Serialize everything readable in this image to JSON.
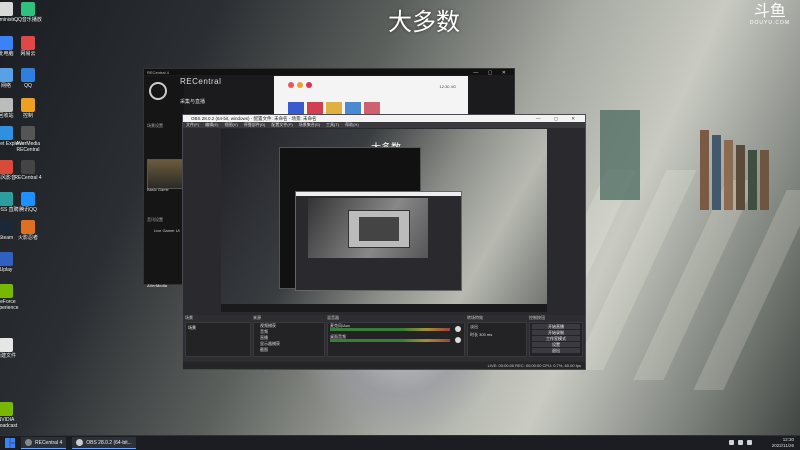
{
  "watermark": {
    "caption": "大多数",
    "logo_cn": "斗鱼",
    "logo_en": "DOUYU.COM"
  },
  "desktop_icons": [
    {
      "label": "Administr...",
      "color": "#d9d9d9"
    },
    {
      "label": "QQ音乐播放",
      "color": "#2ec27e"
    },
    {
      "label": "此电脑",
      "color": "#3b82f6"
    },
    {
      "label": "网易云",
      "color": "#e04848"
    },
    {
      "label": "网络",
      "color": "#5aa0e6"
    },
    {
      "label": "QQ",
      "color": "#2f7fe0"
    },
    {
      "label": "回收站",
      "color": "#bcbcbc"
    },
    {
      "label": "控制",
      "color": "#f0a020"
    },
    {
      "label": "Internet Explorer",
      "color": "#2f8fe0"
    },
    {
      "label": "AVerMedia RECentral",
      "color": "#555555"
    },
    {
      "label": "暴风影音",
      "color": "#d94a3a"
    },
    {
      "label": "RECentral 4",
      "color": "#444444"
    },
    {
      "label": "BOSS 直聘",
      "color": "#2d9e9e"
    },
    {
      "label": "腾讯QQ",
      "color": "#1e90ff"
    },
    {
      "label": "Steam",
      "color": "#1b2838"
    },
    {
      "label": "火影忍者",
      "color": "#e07020"
    },
    {
      "label": "Uplay",
      "color": "#3060c0"
    },
    {
      "label": "GeForce Experience",
      "color": "#76b900"
    },
    {
      "label": "新建文件",
      "color": "#e6e6e6"
    },
    {
      "label": "NVIDIA Broadcast",
      "color": "#76b900"
    }
  ],
  "recentral": {
    "title": "RECentral 4",
    "brand": "RECentral",
    "subtitle": "采集与直播",
    "section_preview": "场景设置",
    "thumb_label": "Basic Game",
    "section_sources": "音讯设置",
    "source_item": "Live Gamer Ul",
    "footer": "AVerMedia",
    "preview_time": "12:30",
    "preview_status": "4G"
  },
  "obs": {
    "title": "OBS 28.0.2 (64-bit, windows) - 配置文件: 未命名 - 场景: 未命名",
    "menu": [
      "文件(F)",
      "编辑(E)",
      "视图(V)",
      "停靠部件(D)",
      "配置文件(P)",
      "场景集合(S)",
      "工具(T)",
      "帮助(H)"
    ],
    "docks": {
      "scenes": {
        "header": "场景",
        "items": [
          "场景"
        ]
      },
      "sources": {
        "header": "来源",
        "items": [
          "视频捕获",
          "音频",
          "直播",
          "显示器捕获",
          "截图",
          "文本"
        ]
      },
      "mixer": {
        "header": "混音器",
        "channels": [
          "麦克风/Aux",
          "桌面音频"
        ]
      },
      "transitions": {
        "header": "转场特效",
        "type": "淡出",
        "duration_label": "时长",
        "duration": "300 ms"
      },
      "controls": {
        "header": "控制按钮",
        "buttons": [
          "开始直播",
          "开始录制",
          "工作室模式",
          "设置",
          "退出"
        ]
      }
    },
    "status": "LIVE: 00:00:00   REC: 00:00:00   CPU: 0.7%, 60.00 fps"
  },
  "taskbar": {
    "apps": [
      {
        "label": "RECentral 4",
        "color": "#888888"
      },
      {
        "label": "OBS 28.0.2 (64-bit...",
        "color": "#cccccc"
      }
    ],
    "time": "12:30",
    "date": "2022/11/26"
  }
}
